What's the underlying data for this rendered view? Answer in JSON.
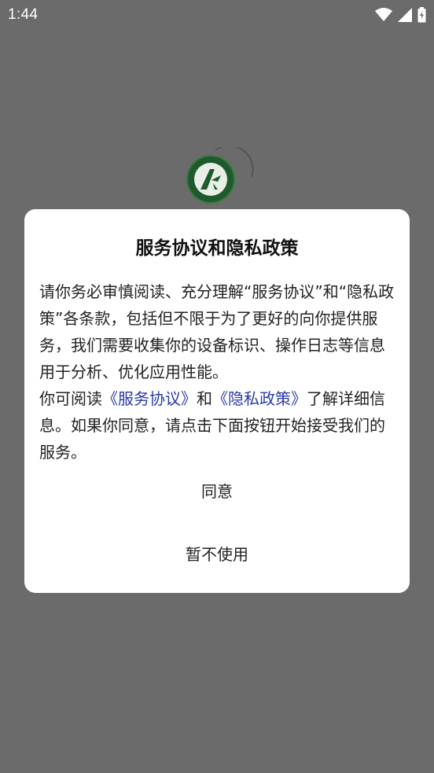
{
  "status_bar": {
    "time": "1:44",
    "icons": [
      "wifi-icon",
      "cell-signal-icon",
      "battery-charging-icon"
    ]
  },
  "splash": {
    "logo_icon": "app-logo-icon",
    "spinner_icon": "loading-spinner-icon"
  },
  "dialog": {
    "title": "服务协议和隐私政策",
    "paragraph1": "请你务必审慎阅读、充分理解“服务协议”和“隐私政策”各条款，包括但不限于为了更好的向你提供服务，我们需要收集你的设备标识、操作日志等信息用于分析、优化应用性能。",
    "paragraph2_prefix": "你可阅读",
    "link_service": "《服务协议》",
    "paragraph2_and": "和",
    "link_privacy": "《隐私政策》",
    "paragraph2_suffix": "了解详细信息。如果你同意，请点击下面按钮开始接受我们的服务。",
    "agree_label": "同意",
    "decline_label": "暂不使用"
  },
  "colors": {
    "overlay": "#6b6b6b",
    "dialog_bg": "#ffffff",
    "link": "#2c3aa8",
    "logo_green": "#1f5a2e"
  }
}
